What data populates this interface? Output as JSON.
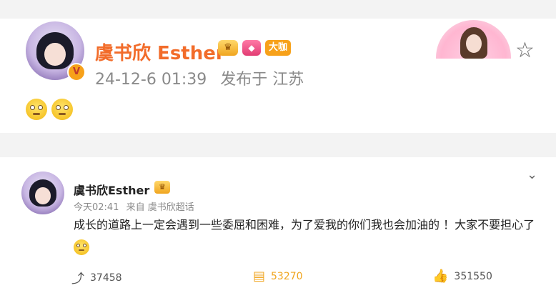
{
  "post": {
    "author": "虞书欣 Esther",
    "badge_big": "大咖",
    "timestamp": "24-12-6 01:39",
    "location": "发布于 江苏",
    "icons": [
      "star-icon",
      "v-verified-badge-icon",
      "crown-badge-icon",
      "gem-badge-icon",
      "emoji-icon",
      "emoji-icon"
    ]
  },
  "comment": {
    "author": "虞书欣Esther",
    "time": "今天02:41",
    "source": "来自 虞书欣超话",
    "text": "成长的道路上一定会遇到一些委屈和困难，为了爱我的你们我也会加油的 ！大家不要担心了",
    "actions": {
      "share_count": "37458",
      "comment_count": "53270",
      "like_count": "351550"
    }
  },
  "colors": {
    "author_name": "#f26c2a",
    "background": "#f3f3f3",
    "verified_badge": "#f7a11a"
  }
}
